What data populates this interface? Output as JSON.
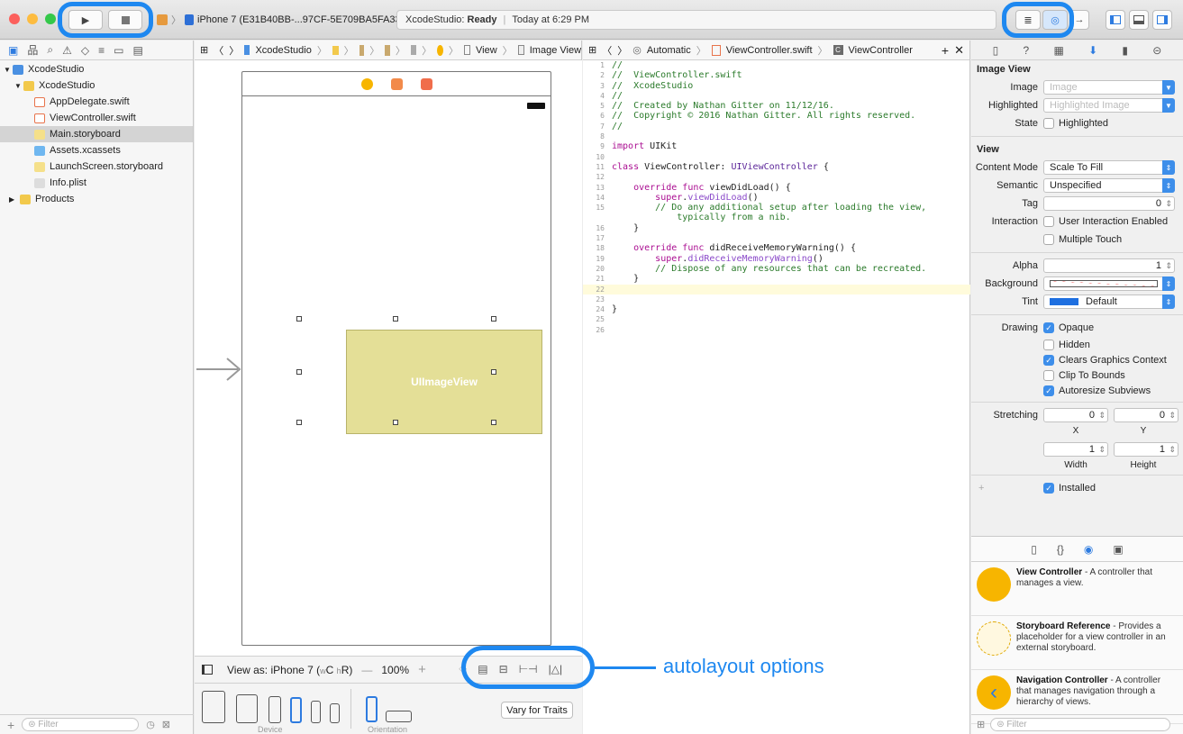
{
  "toolbar": {
    "scheme_target": "iPhone 7 (E31B40BB-...97CF-5E709BA5FA33)",
    "status_app": "XcodeStudio:",
    "status_state": "Ready",
    "status_time": "Today at 6:29 PM"
  },
  "navigator": {
    "items": [
      {
        "label": "XcodeStudio"
      },
      {
        "label": "XcodeStudio"
      },
      {
        "label": "AppDelegate.swift"
      },
      {
        "label": "ViewController.swift"
      },
      {
        "label": "Main.storyboard"
      },
      {
        "label": "Assets.xcassets"
      },
      {
        "label": "LaunchScreen.storyboard"
      },
      {
        "label": "Info.plist"
      },
      {
        "label": "Products"
      }
    ],
    "filter_placeholder": "Filter"
  },
  "ib": {
    "breadcrumb": [
      "XcodeStudio",
      "View",
      "Image View"
    ],
    "imageview_label": "UIImageView",
    "view_as": "View as: iPhone 7 (",
    "view_as_w": "w",
    "view_as_c": "C ",
    "view_as_h": "h",
    "view_as_r": "R)",
    "zoom": "100%",
    "device_label": "Device",
    "orientation_label": "Orientation",
    "vary_traits": "Vary for Traits"
  },
  "editor": {
    "breadcrumb": [
      "Automatic",
      "ViewController.swift",
      "ViewController"
    ],
    "lines": [
      "//",
      "//  ViewController.swift",
      "//  XcodeStudio",
      "//",
      "//  Created by Nathan Gitter on 11/12/16.",
      "//  Copyright © 2016 Nathan Gitter. All rights reserved.",
      "//",
      "",
      "import UIKit",
      "",
      "class ViewController: UIViewController {",
      "",
      "    override func viewDidLoad() {",
      "        super.viewDidLoad()",
      "        // Do any additional setup after loading the view,",
      "            typically from a nib.",
      "    }",
      "",
      "    override func didReceiveMemoryWarning() {",
      "        super.didReceiveMemoryWarning()",
      "        // Dispose of any resources that can be recreated.",
      "    }",
      "",
      "",
      "}",
      "",
      ""
    ],
    "gutter": [
      "1",
      "2",
      "3",
      "4",
      "5",
      "6",
      "7",
      "8",
      "9",
      "10",
      "11",
      "12",
      "13",
      "14",
      "15",
      "",
      "16",
      "17",
      "18",
      "19",
      "20",
      "21",
      "22",
      "23",
      "24",
      "25",
      "26"
    ]
  },
  "inspector": {
    "image_view_title": "Image View",
    "image_label": "Image",
    "image_placeholder": "Image",
    "highlighted_label": "Highlighted",
    "highlighted_placeholder": "Highlighted Image",
    "state_label": "State",
    "state_value": "Highlighted",
    "view_title": "View",
    "content_mode_label": "Content Mode",
    "content_mode_value": "Scale To Fill",
    "semantic_label": "Semantic",
    "semantic_value": "Unspecified",
    "tag_label": "Tag",
    "tag_value": "0",
    "interaction_label": "Interaction",
    "user_interaction": "User Interaction Enabled",
    "multiple_touch": "Multiple Touch",
    "alpha_label": "Alpha",
    "alpha_value": "1",
    "background_label": "Background",
    "tint_label": "Tint",
    "tint_value": "Default",
    "drawing_label": "Drawing",
    "opaque": "Opaque",
    "hidden": "Hidden",
    "clears_graphics": "Clears Graphics Context",
    "clip_bounds": "Clip To Bounds",
    "autoresize": "Autoresize Subviews",
    "stretching_label": "Stretching",
    "stretch_x": "0",
    "stretch_y": "0",
    "stretch_w": "1",
    "stretch_h": "1",
    "x_label": "X",
    "y_label": "Y",
    "width_label": "Width",
    "height_label": "Height",
    "installed": "Installed",
    "filter_placeholder": "Filter"
  },
  "library": [
    {
      "title": "View Controller",
      "desc": " - A controller that manages a view."
    },
    {
      "title": "Storyboard Reference",
      "desc": " - Provides a placeholder for a view controller in an external storyboard."
    },
    {
      "title": "Navigation Controller",
      "desc": " - A controller that manages navigation through a hierarchy of views."
    }
  ],
  "annotation": "autolayout options",
  "colors": {
    "highlight": "#1e88f0",
    "imageview": "#e4df97",
    "accent": "#3d8eea"
  }
}
